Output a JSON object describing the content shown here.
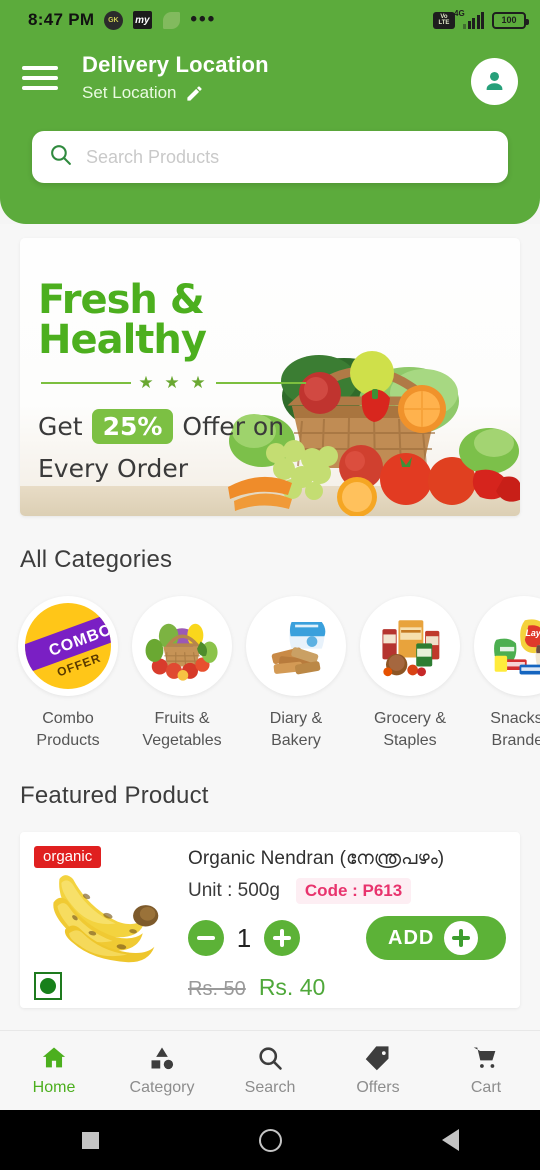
{
  "status_bar": {
    "time": "8:47 PM",
    "app_icons": [
      "gk-notification-icon",
      "my-notification-icon",
      "leaf-notification-icon"
    ],
    "overflow": "•••",
    "volte_top": "Vo",
    "volte_bottom": "LTE",
    "network": "4G",
    "battery": "100"
  },
  "header": {
    "menu_icon": "hamburger-menu-icon",
    "title": "Delivery Location",
    "subtitle": "Set Location",
    "edit_icon": "pencil-edit-icon",
    "profile_icon": "person-avatar-icon",
    "accent_color": "#5CAB3C"
  },
  "search": {
    "placeholder": "Search Products",
    "value": "",
    "icon": "search-icon"
  },
  "banner": {
    "headline": "Fresh & Healthy",
    "stars": "★ ★ ★",
    "line2_pre": "Get",
    "percent": "25%",
    "line2_post": "Offer on",
    "line3": "Every Order",
    "image": "fruit-vegetable-basket-image",
    "highlight_color": "#7cc043"
  },
  "categories": {
    "title": "All Categories",
    "items": [
      {
        "label": "Combo\nProducts",
        "line1": "Combo",
        "line2": "Products",
        "icon": "combo-offer-badge-image",
        "combo_text1": "COMBO",
        "combo_text2": "OFFER"
      },
      {
        "label": "Fruits &\nVegetables",
        "line1": "Fruits &",
        "line2": "Vegetables",
        "icon": "fruits-vegetables-basket-image"
      },
      {
        "label": "Diary &\nBakery",
        "line1": "Diary &",
        "line2": "Bakery",
        "icon": "dairy-bakery-bread-image"
      },
      {
        "label": "Grocery &\nStaples",
        "line1": "Grocery &",
        "line2": "Staples",
        "icon": "grocery-staples-packets-image"
      },
      {
        "label": "Snacks &\nBranded.",
        "line1": "Snacks &",
        "line2": "Branded.",
        "icon": "snacks-branded-packets-image"
      }
    ]
  },
  "featured": {
    "title": "Featured Product",
    "product": {
      "badge": "organic",
      "image": "banana-bunch-image",
      "veg_indicator": "veg-indicator-icon",
      "name": "Organic Nendran (നേന്ത്രപഴം)",
      "unit_label": "Unit : 500g",
      "code_label": "Code : P613",
      "quantity": "1",
      "decrement_icon": "minus-icon",
      "increment_icon": "plus-icon",
      "add_label": "ADD",
      "add_icon": "plus-icon",
      "old_price": "Rs. 50",
      "new_price": "Rs. 40",
      "badge_color": "#E02020",
      "code_color": "#e8336d",
      "price_color": "#4fa83a"
    }
  },
  "bottom_nav": {
    "active_color": "#4caf1e",
    "items": [
      {
        "label": "Home",
        "icon": "home-icon",
        "active": true
      },
      {
        "label": "Category",
        "icon": "category-shapes-icon",
        "active": false
      },
      {
        "label": "Search",
        "icon": "search-icon",
        "active": false
      },
      {
        "label": "Offers",
        "icon": "tag-offer-icon",
        "active": false
      },
      {
        "label": "Cart",
        "icon": "shopping-cart-icon",
        "active": false
      }
    ]
  },
  "system_nav": {
    "recents": "recents-square-icon",
    "home": "home-circle-icon",
    "back": "back-triangle-icon"
  }
}
